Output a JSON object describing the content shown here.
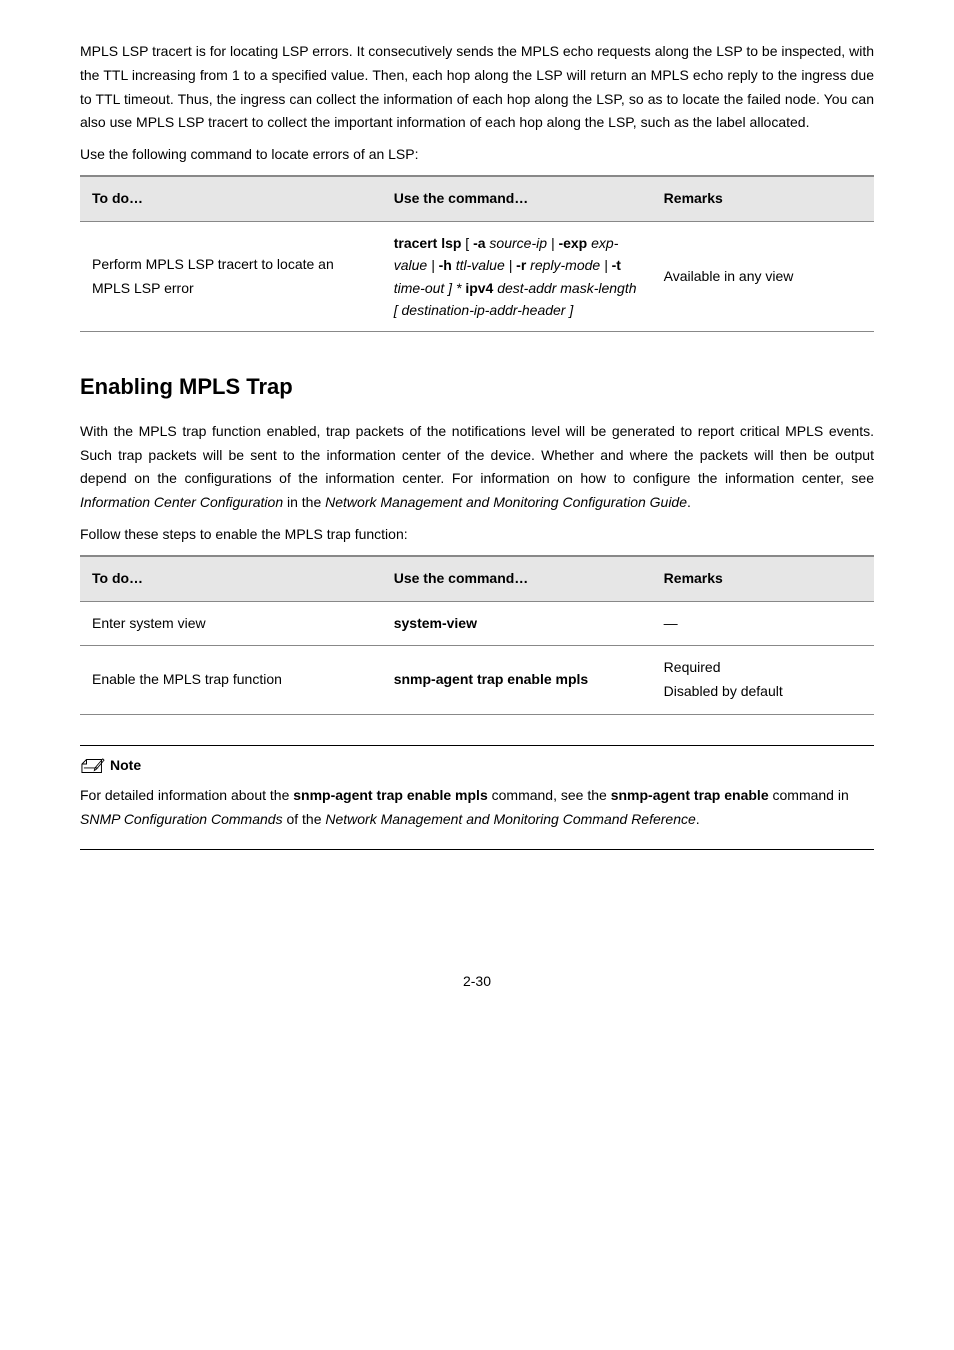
{
  "p1": "MPLS LSP tracert is for locating LSP errors. It consecutively sends the MPLS echo requests along the LSP to be inspected, with the TTL increasing from 1 to a specified value. Then, each hop along the LSP will return an MPLS echo reply to the ingress due to TTL timeout. Thus, the ingress can collect the information of each hop along the LSP, so as to locate the failed node. You can also use MPLS LSP tracert to collect the important information of each hop along the LSP, such as the label allocated.",
  "p2": "Use the following command to locate errors of an LSP:",
  "table1": {
    "h1": "To do…",
    "h2": "Use the command…",
    "h3": "Remarks",
    "r1c1": "Perform MPLS LSP tracert to locate an MPLS LSP error",
    "r1c2_1": "tracert lsp",
    "r1c2_2": " [ ",
    "r1c2_3": "-a",
    "r1c2_4": " source-ip | ",
    "r1c2_5": "-exp",
    "r1c2_6": " exp-value | ",
    "r1c2_7": "-h",
    "r1c2_8": " ttl-value | ",
    "r1c2_9": "-r",
    "r1c2_10": " reply-mode | ",
    "r1c2_11": "-t",
    "r1c2_12": " time-out ] * ",
    "r1c2_13": "ipv4",
    "r1c2_14": " dest-addr mask-length [ destination-ip-addr-header ]",
    "r1c3": "Available in any view"
  },
  "heading": "Enabling MPLS Trap",
  "p3a": "With the MPLS trap function enabled, trap packets of the notifications level will be generated to report critical MPLS events. Such trap packets will be sent to the information center of the device. Whether and where the packets will then be output depend on the configurations of the information center. For information on how to configure the information center, see ",
  "p3b": "Information Center Configuration",
  "p3c": " in the ",
  "p3d": "Network Management and Monitoring Configuration Guide",
  "p3e": ".",
  "p4": "Follow these steps to enable the MPLS trap function:",
  "table2": {
    "h1": "To do…",
    "h2": "Use the command…",
    "h3": "Remarks",
    "r1c1": "Enter system view",
    "r1c2": "system-view",
    "r1c3": "—",
    "r2c1": "Enable the MPLS trap function",
    "r2c2": "snmp-agent trap enable mpls",
    "r2c3a": "Required",
    "r2c3b": "Disabled by default"
  },
  "noteLabel": "Note",
  "note_a": "For detailed information about the ",
  "note_b": "snmp-agent trap enable mpls",
  "note_c": " command, see the ",
  "note_d": "snmp-agent trap enable",
  "note_e": " command in ",
  "note_f": "SNMP Configuration Commands",
  "note_g": " of the ",
  "note_h": "Network Management and Monitoring Command Reference",
  "note_i": ".",
  "pageNum": "2-30"
}
